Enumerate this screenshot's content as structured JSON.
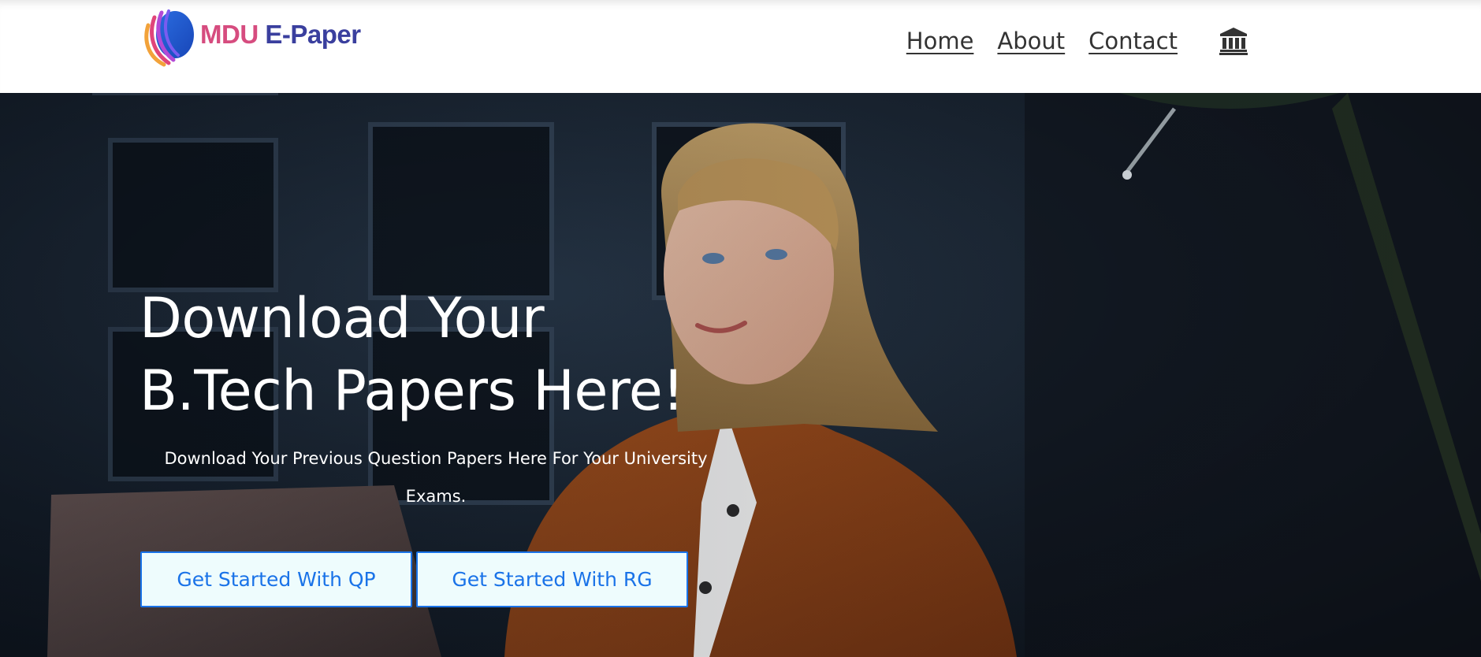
{
  "brand": {
    "name_part1": "MDU",
    "name_part2": "E-Paper",
    "logo_icon": "book-swoosh-logo"
  },
  "nav": {
    "links": [
      "Home",
      "About",
      "Contact"
    ],
    "icon": "bank-icon"
  },
  "hero": {
    "title_line1": "Download Your",
    "title_line2": "B.Tech Papers Here!",
    "subtitle": "Download Your Previous Question Papers Here For Your University Exams.",
    "buttons": {
      "qp": "Get Started With QP",
      "rg": "Get Started With RG"
    }
  },
  "colors": {
    "brand_pink": "#d64c7f",
    "brand_indigo": "#3a3f9e",
    "button_text": "#1a73e8",
    "button_bg": "#eefcfd",
    "hero_bg": "#11161d"
  }
}
